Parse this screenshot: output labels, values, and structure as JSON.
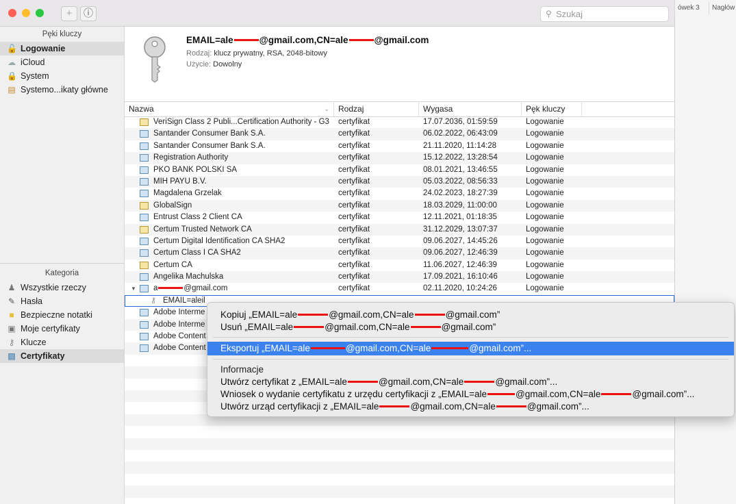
{
  "toolbar": {
    "search_placeholder": "Szukaj",
    "add_glyph": "+",
    "info_glyph": "ⓘ",
    "background_tabs": [
      "ówek 3",
      "Nagłów"
    ]
  },
  "sidebar": {
    "keychains_header": "Pęki kluczy",
    "keychains": [
      {
        "label": "Logowanie",
        "icon": "lock-open-icon",
        "selected": true
      },
      {
        "label": "iCloud",
        "icon": "cloud-icon",
        "selected": false
      },
      {
        "label": "System",
        "icon": "lock-icon",
        "selected": false
      },
      {
        "label": "Systemo...ikaty główne",
        "icon": "cabinet-icon",
        "selected": false
      }
    ],
    "category_header": "Kategoria",
    "categories": [
      {
        "label": "Wszystkie rzeczy",
        "icon": "people-icon",
        "selected": false
      },
      {
        "label": "Hasła",
        "icon": "pencil-icon",
        "selected": false
      },
      {
        "label": "Bezpieczne notatki",
        "icon": "note-icon",
        "selected": false
      },
      {
        "label": "Moje certyfikaty",
        "icon": "my-cert-icon",
        "selected": false
      },
      {
        "label": "Klucze",
        "icon": "key-icon",
        "selected": false
      },
      {
        "label": "Certyfikaty",
        "icon": "certificate-icon",
        "selected": true
      }
    ]
  },
  "info": {
    "title_prefix": "EMAIL=ale",
    "title_mid": "@gmail.com,CN=ale",
    "title_suffix": "@gmail.com",
    "type_label": "Rodzaj:",
    "type_value": "klucz prywatny, RSA, 2048-bitowy",
    "usage_label": "Użycie:",
    "usage_value": "Dowolny"
  },
  "table": {
    "headers": [
      "Nazwa",
      "Rodzaj",
      "Wygasa",
      "Pęk kluczy"
    ],
    "rows": [
      {
        "name": "VeriSign Class 2 Publi...Certification Authority - G3",
        "kind": "certyfikat",
        "expires": "17.07.2036, 01:59:59",
        "keychain": "Logowanie",
        "icon": "gold"
      },
      {
        "name": "Santander Consumer Bank S.A.",
        "kind": "certyfikat",
        "expires": "06.02.2022, 06:43:09",
        "keychain": "Logowanie",
        "icon": "blue"
      },
      {
        "name": "Santander Consumer Bank S.A.",
        "kind": "certyfikat",
        "expires": "21.11.2020, 11:14:28",
        "keychain": "Logowanie",
        "icon": "blue"
      },
      {
        "name": "Registration Authority",
        "kind": "certyfikat",
        "expires": "15.12.2022, 13:28:54",
        "keychain": "Logowanie",
        "icon": "blue"
      },
      {
        "name": "PKO BANK POLSKI SA",
        "kind": "certyfikat",
        "expires": "08.01.2021, 13:46:55",
        "keychain": "Logowanie",
        "icon": "blue"
      },
      {
        "name": "MIH PAYU B.V.",
        "kind": "certyfikat",
        "expires": "05.03.2022, 08:56:33",
        "keychain": "Logowanie",
        "icon": "blue"
      },
      {
        "name": "Magdalena Grzelak",
        "kind": "certyfikat",
        "expires": "24.02.2023, 18:27:39",
        "keychain": "Logowanie",
        "icon": "blue"
      },
      {
        "name": "GlobalSign",
        "kind": "certyfikat",
        "expires": "18.03.2029, 11:00:00",
        "keychain": "Logowanie",
        "icon": "gold"
      },
      {
        "name": "Entrust Class 2 Client CA",
        "kind": "certyfikat",
        "expires": "12.11.2021, 01:18:35",
        "keychain": "Logowanie",
        "icon": "blue"
      },
      {
        "name": "Certum Trusted Network CA",
        "kind": "certyfikat",
        "expires": "31.12.2029, 13:07:37",
        "keychain": "Logowanie",
        "icon": "gold"
      },
      {
        "name": "Certum Digital Identification CA SHA2",
        "kind": "certyfikat",
        "expires": "09.06.2027, 14:45:26",
        "keychain": "Logowanie",
        "icon": "blue"
      },
      {
        "name": "Certum Class I CA SHA2",
        "kind": "certyfikat",
        "expires": "09.06.2027, 12:46:39",
        "keychain": "Logowanie",
        "icon": "blue"
      },
      {
        "name": "Certum CA",
        "kind": "certyfikat",
        "expires": "11.06.2027, 12:46:39",
        "keychain": "Logowanie",
        "icon": "gold"
      },
      {
        "name": "Angelika Machulska",
        "kind": "certyfikat",
        "expires": "17.09.2021, 16:10:46",
        "keychain": "Logowanie",
        "icon": "blue"
      },
      {
        "name": "a@gmail.com",
        "kind": "certyfikat",
        "expires": "02.11.2020, 10:24:26",
        "keychain": "Logowanie",
        "icon": "blue",
        "expanded": true
      },
      {
        "name": "EMAIL=aleil",
        "kind": "",
        "expires": "",
        "keychain": "",
        "icon": "key",
        "selected": true
      },
      {
        "name": "Adobe Interme",
        "kind": "",
        "expires": "",
        "keychain": "",
        "icon": "blue"
      },
      {
        "name": "Adobe Interme",
        "kind": "",
        "expires": "",
        "keychain": "",
        "icon": "blue"
      },
      {
        "name": "Adobe Content",
        "kind": "",
        "expires": "",
        "keychain": "",
        "icon": "blue"
      },
      {
        "name": "Adobe Content",
        "kind": "",
        "expires": "",
        "keychain": "",
        "icon": "blue"
      }
    ]
  },
  "context_menu": {
    "copy": [
      "Kopiuj „EMAIL=ale",
      "@gmail.com,CN=ale",
      "@gmail.com”"
    ],
    "delete": [
      "Usuń „EMAIL=ale",
      "@gmail.com,CN=ale",
      "@gmail.com”"
    ],
    "export": [
      "Eksportuj „EMAIL=ale",
      "@gmail.com,CN=ale",
      "@gmail.com”..."
    ],
    "info": "Informacje",
    "create_cert": [
      "Utwórz certyfikat z „EMAIL=ale",
      "@gmail.com,CN=ale",
      "@gmail.com”..."
    ],
    "request_cert": [
      "Wniosek o wydanie certyfikatu z urzędu certyfikacji z „EMAIL=ale",
      "@gmail.com,CN=ale",
      "@gmail.com”..."
    ],
    "create_ca": [
      "Utwórz urząd certyfikacji z „EMAIL=ale",
      "@gmail.com,CN=ale",
      "@gmail.com”..."
    ]
  },
  "colors": {
    "highlight": "#3b82ef",
    "redaction": "#e11111",
    "traffic_red": "#fe5f57",
    "traffic_yellow": "#febc2e",
    "traffic_green": "#28c840"
  }
}
